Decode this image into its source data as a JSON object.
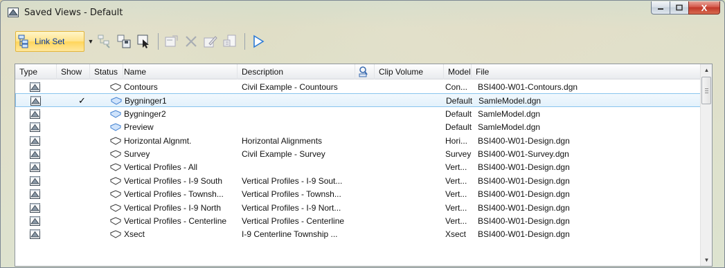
{
  "window": {
    "title": "Saved Views - Default",
    "close_glyph": "X"
  },
  "toolbar": {
    "linkset_label": "Link Set"
  },
  "columns": {
    "type": "Type",
    "show": "Show",
    "status": "Status",
    "name": "Name",
    "description": "Description",
    "clip_volume": "Clip Volume",
    "model": "Model",
    "file": "File"
  },
  "rows": [
    {
      "show": "",
      "status_icon": "saved-view-icon",
      "name": "Contours",
      "description": "Civil Example - Countours",
      "model": "Con...",
      "file": "BSI400-W01-Contours.dgn",
      "selected": false
    },
    {
      "show": "✓",
      "status_icon": "saved-view-blue-icon",
      "name": "Bygninger1",
      "description": "",
      "model": "Default",
      "file": "SamleModel.dgn",
      "selected": true
    },
    {
      "show": "",
      "status_icon": "saved-view-blue-icon",
      "name": "Bygninger2",
      "description": "",
      "model": "Default",
      "file": "SamleModel.dgn",
      "selected": false
    },
    {
      "show": "",
      "status_icon": "saved-view-blue-icon",
      "name": "Preview",
      "description": "",
      "model": "Default",
      "file": "SamleModel.dgn",
      "selected": false
    },
    {
      "show": "",
      "status_icon": "saved-view-icon",
      "name": "Horizontal Algnmt.",
      "description": "Horizontal Alignments",
      "model": "Hori...",
      "file": "BSI400-W01-Design.dgn",
      "selected": false
    },
    {
      "show": "",
      "status_icon": "saved-view-icon",
      "name": "Survey",
      "description": "Civil Example - Survey",
      "model": "Survey",
      "file": "BSI400-W01-Survey.dgn",
      "selected": false
    },
    {
      "show": "",
      "status_icon": "saved-view-icon",
      "name": "Vertical Profiles - All",
      "description": "",
      "model": "Vert...",
      "file": "BSI400-W01-Design.dgn",
      "selected": false
    },
    {
      "show": "",
      "status_icon": "saved-view-icon",
      "name": "Vertical Profiles - I-9 South",
      "description": "Vertical Profiles - I-9 Sout...",
      "model": "Vert...",
      "file": "BSI400-W01-Design.dgn",
      "selected": false
    },
    {
      "show": "",
      "status_icon": "saved-view-icon",
      "name": "Vertical Profiles - Townsh...",
      "description": "Vertical Profiles - Townsh...",
      "model": "Vert...",
      "file": "BSI400-W01-Design.dgn",
      "selected": false
    },
    {
      "show": "",
      "status_icon": "saved-view-icon",
      "name": "Vertical Profiles - I-9 North",
      "description": "Vertical Profiles - I-9 Nort...",
      "model": "Vert...",
      "file": "BSI400-W01-Design.dgn",
      "selected": false
    },
    {
      "show": "",
      "status_icon": "saved-view-icon",
      "name": "Vertical Profiles - Centerline",
      "description": "Vertical Profiles - Centerline",
      "model": "Vert...",
      "file": "BSI400-W01-Design.dgn",
      "selected": false
    },
    {
      "show": "",
      "status_icon": "saved-view-icon",
      "name": "Xsect",
      "description": "I-9 Centerline Township ...",
      "model": "Xsect",
      "file": "BSI400-W01-Design.dgn",
      "selected": false
    }
  ],
  "colors": {
    "selected_row_bg": "#e3f1fb",
    "selected_row_border": "#88c4ee",
    "linkset_bg": "#ffe38a",
    "close_button": "#c0372a"
  }
}
